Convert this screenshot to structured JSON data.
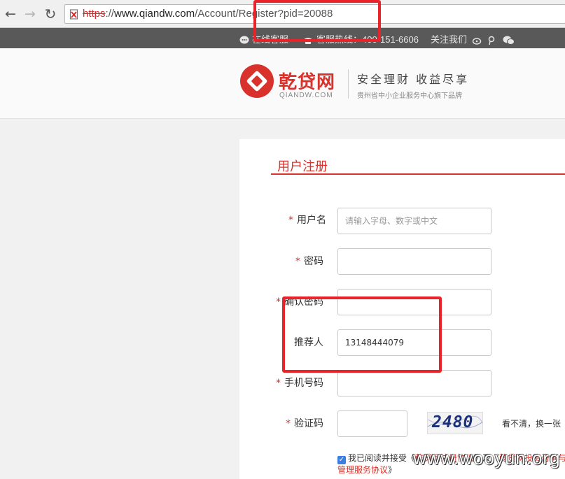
{
  "browser": {
    "url_scheme": "https",
    "url_sep": "://",
    "url_host": "www.qiandw.com",
    "url_path": "/Account/Register?pid=20088"
  },
  "topbar": {
    "online_service": "在线客服",
    "hotline": "客服热线：400-151-6606",
    "follow": "关注我们"
  },
  "header": {
    "logo_cn": "乾贷网",
    "logo_en": "QIANDW.COM",
    "slogan": "安全理财 收益尽享",
    "slogan_sub": "贵州省中小企业服务中心旗下品牌"
  },
  "form": {
    "title": "用户注册",
    "required_mark": "*",
    "username_label": "用户名",
    "username_placeholder": "请输入字母、数字或中文",
    "password_label": "密码",
    "confirm_label": "确认密码",
    "referrer_label": "推荐人",
    "referrer_value": "13148444079",
    "phone_label": "手机号码",
    "captcha_label": "验证码",
    "captcha_text": "2480",
    "refresh_text": "看不清，换一张",
    "agree_prefix": "我已阅读并接受《",
    "agreement1": "乾贷网注册协议",
    "agree_mid": "》及《",
    "agreement2": "乾贷网投资咨询与管理服务协议",
    "agree_suffix": "》"
  },
  "watermark": "www.wooyun.org",
  "colors": {
    "brand_red": "#d9312b",
    "annotation_red": "#e8232a",
    "topbar_bg": "#595959"
  }
}
